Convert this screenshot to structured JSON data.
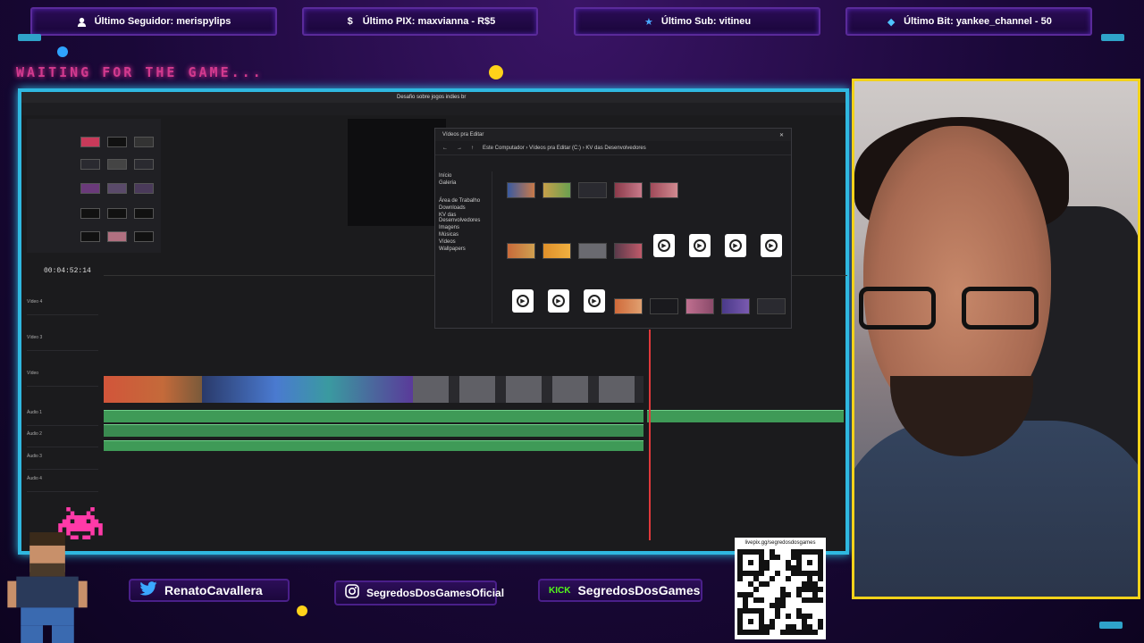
{
  "alerts": [
    {
      "icon": "user-icon",
      "label": "Último Seguidor: merispylips"
    },
    {
      "icon": "dollar-icon",
      "label": "Último PIX: maxvianna - R$5"
    },
    {
      "icon": "star-icon",
      "label": "Último Sub: vitineu"
    },
    {
      "icon": "diamond-icon",
      "label": "Último Bit: yankee_channel - 50"
    }
  ],
  "waiting_text": "WAITING FOR THE GAME...",
  "editor": {
    "window_title": "Desafio sobre jogos indies br",
    "timecode": "00:04:52:14",
    "tracks": [
      "Vídeo 4",
      "Vídeo 3",
      "Vídeo",
      "Áudio 1",
      "Áudio 2",
      "Áudio 3",
      "Áudio 4"
    ]
  },
  "explorer": {
    "tab_label": "Vídeos pra Editar",
    "address": "Este Computador › Vídeos pra Editar (C:) › KV das Desenvolvedores",
    "nav_items": [
      "Início",
      "Galeria",
      "Área de Trabalho",
      "Downloads",
      "KV das Desenvolvedores",
      "Imagens",
      "Músicas",
      "Vídeos",
      "Wallpapers"
    ]
  },
  "social": [
    {
      "icon": "twitter-icon",
      "name": "RenatoCavallera"
    },
    {
      "icon": "instagram-icon",
      "name": "SegredosDosGamesOficial"
    },
    {
      "icon": "kick-icon",
      "badge": "KICK",
      "name": "SegredosDosGames"
    }
  ],
  "qr_url": "livepix.gg/segredosdosgames",
  "colors": {
    "accent_cyan": "#2fb8e0",
    "webcam_border": "#f2d21a",
    "audio_green": "#3f9a57",
    "playhead": "#e0393b"
  }
}
